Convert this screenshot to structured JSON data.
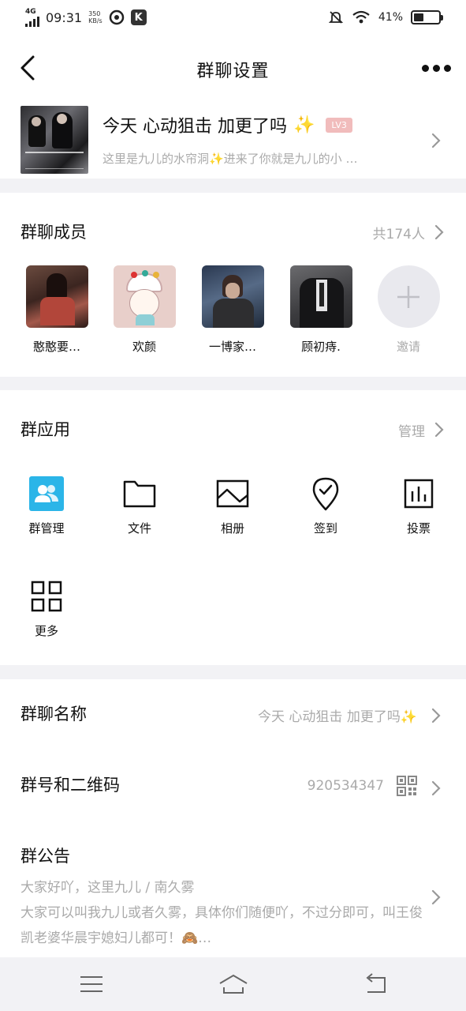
{
  "status_bar": {
    "network": "4G",
    "time": "09:31",
    "speed_value": "350",
    "speed_unit": "KB/s",
    "k_badge": "K",
    "battery_percent": "41%",
    "battery_level": 0.41
  },
  "nav": {
    "title": "群聊设置"
  },
  "group": {
    "name": "今天 心动狙击 加更了吗",
    "name_emoji": "✨",
    "level": "LV3",
    "description": "这里是九儿的水帘洞✨进来了你就是九儿的小 …"
  },
  "members": {
    "title": "群聊成员",
    "count": "共174人",
    "items": [
      {
        "name": "憨憨要…"
      },
      {
        "name": "欢颜"
      },
      {
        "name": "一博家…"
      },
      {
        "name": "顾初痔."
      },
      {
        "name": "邀请"
      }
    ]
  },
  "apps": {
    "title": "群应用",
    "manage": "管理",
    "items": [
      {
        "label": "群管理",
        "icon": "group-manage-icon"
      },
      {
        "label": "文件",
        "icon": "folder-icon"
      },
      {
        "label": "相册",
        "icon": "album-icon"
      },
      {
        "label": "签到",
        "icon": "checkin-icon"
      },
      {
        "label": "投票",
        "icon": "vote-icon"
      },
      {
        "label": "更多",
        "icon": "grid-icon"
      }
    ]
  },
  "settings": {
    "group_name_label": "群聊名称",
    "group_name_value": "今天 心动狙击 加更了吗✨",
    "group_number_label": "群号和二维码",
    "group_number_value": "920534347",
    "notice_label": "群公告",
    "notice_text": "大家好吖，这里九儿 / 南久雾\n大家可以叫我九儿或者久雾，具体你们随便吖，不过分即可，叫王俊凯老婆华晨宇媳妇儿都可！🙈…"
  },
  "colors": {
    "accent_blue": "#2bb5e8",
    "level_badge": "#f1bcbc",
    "muted_text": "#aaaaaa",
    "background": "#f2f2f5"
  }
}
